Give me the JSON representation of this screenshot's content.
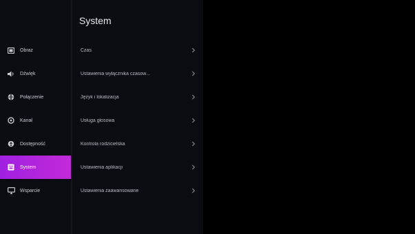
{
  "sidebar": {
    "items": [
      {
        "label": "Obraz",
        "icon": "picture-icon"
      },
      {
        "label": "Dźwięk",
        "icon": "speaker-icon"
      },
      {
        "label": "Połączenie",
        "icon": "globe-icon"
      },
      {
        "label": "Kanał",
        "icon": "channel-icon"
      },
      {
        "label": "Dostępność",
        "icon": "accessibility-icon"
      },
      {
        "label": "System",
        "icon": "system-icon",
        "active": true
      },
      {
        "label": "Wsparcie",
        "icon": "support-icon"
      }
    ]
  },
  "panel": {
    "title": "System",
    "items": [
      {
        "label": "Czas"
      },
      {
        "label": "Ustawienia wyłącznika czasow..."
      },
      {
        "label": "Język i lokalizacja"
      },
      {
        "label": "Usługa głosowa"
      },
      {
        "label": "Kontrola rodzicielska"
      },
      {
        "label": "Ustawienia aplikacji"
      },
      {
        "label": "Ustawienia zaawansowane"
      }
    ]
  },
  "colors": {
    "accent": "#b524dc",
    "sidebar_bg": "#0b0c12",
    "background": "#000000"
  }
}
